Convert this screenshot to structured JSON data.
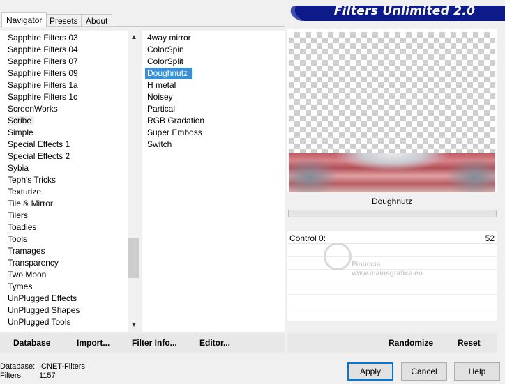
{
  "banner": {
    "title": "Filters Unlimited 2.0",
    "color": "#0c1a8a"
  },
  "tabs": [
    {
      "label": "Navigator",
      "active": true
    },
    {
      "label": "Presets",
      "active": false
    },
    {
      "label": "About",
      "active": false
    }
  ],
  "categories": [
    "Sapphire Filters 03",
    "Sapphire Filters 04",
    "Sapphire Filters 07",
    "Sapphire Filters 09",
    "Sapphire Filters 1a",
    "Sapphire Filters 1c",
    "ScreenWorks",
    "Scribe",
    "Simple",
    "Special Effects 1",
    "Special Effects 2",
    "Sybia",
    "Teph's Tricks",
    "Texturize",
    "Tile & Mirror",
    "Tilers",
    "Toadies",
    "Tools",
    "Tramages",
    "Transparency",
    "Two Moon",
    "Tymes",
    "UnPlugged Effects",
    "UnPlugged Shapes",
    "UnPlugged Tools"
  ],
  "highlighted_category": "Scribe",
  "filters": [
    "4way mirror",
    "ColorSpin",
    "ColorSplit",
    "Doughnutz",
    "H metal",
    "Noisey",
    "Partical",
    "RGB Gradation",
    "Super Emboss",
    "Switch"
  ],
  "selected_filter": "Doughnutz",
  "preview": {
    "filter_name": "Doughnutz"
  },
  "controls": [
    {
      "label": "Control 0:",
      "value": "52"
    }
  ],
  "watermark": {
    "line1": "Pinuccia",
    "line2": "www.mainsgrafica.eu"
  },
  "left_actions": {
    "database": "Database",
    "import": "Import...",
    "filter_info": "Filter Info...",
    "editor": "Editor..."
  },
  "right_actions": {
    "randomize": "Randomize",
    "reset": "Reset"
  },
  "status": {
    "database_label": "Database:",
    "database_value": "ICNET-Filters",
    "filters_label": "Filters:",
    "filters_value": "1157"
  },
  "buttons": {
    "apply": "Apply",
    "cancel": "Cancel",
    "help": "Help"
  },
  "scroll": {
    "thumb_position": 0.82
  }
}
